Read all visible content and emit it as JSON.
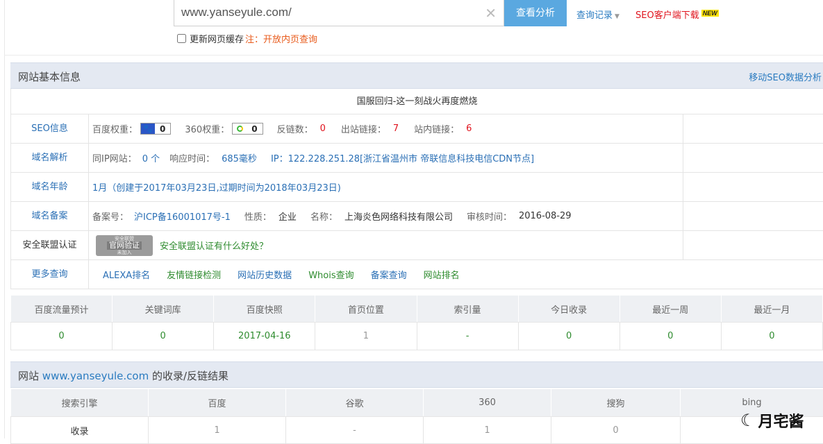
{
  "search": {
    "value": "www.yanseyule.com/",
    "submit_label": "查看分析",
    "history_label": "查询记录",
    "client_label": "SEO客户端下载",
    "new_badge": "NEW",
    "cache_label": "更新网页缓存",
    "cache_note": "注：开放内页查询"
  },
  "basic_info": {
    "title": "网站基本信息",
    "mobile_link": "移动SEO数据分析",
    "site_caption": "国服回归-这一刻战火再度燃烧",
    "seo": {
      "label": "SEO信息",
      "baidu_weight_label": "百度权重：",
      "baidu_weight": "0",
      "w360_label": "360权重：",
      "w360": "0",
      "backlinks_label": "反链数：",
      "backlinks": "0",
      "outlinks_label": "出站链接：",
      "outlinks": "7",
      "inlinks_label": "站内链接：",
      "inlinks": "6"
    },
    "dns": {
      "label": "域名解析",
      "same_ip_label": "同IP网站：",
      "same_ip": "0 个",
      "response_label": "响应时间：",
      "response": "685毫秒",
      "ip": "IP：122.228.251.28[浙江省温州市 帝联信息科技电信CDN节点]"
    },
    "age": {
      "label": "域名年龄",
      "value": "1月（创建于2017年03月23日,过期时间为2018年03月23日)"
    },
    "icp": {
      "label": "域名备案",
      "num_label": "备案号：",
      "num": "沪ICP备16001017号-1",
      "nature_label": "性质：",
      "nature": "企业",
      "name_label": "名称：",
      "name": "上海炎色网络科技有限公司",
      "audit_label": "审核时间：",
      "audit": "2016-08-29"
    },
    "alliance": {
      "label": "安全联盟认证",
      "seal_top": "安全联盟",
      "seal_mid": "官网验证",
      "seal_bottom": "未加入",
      "link": "安全联盟认证有什么好处？"
    },
    "more": {
      "label": "更多查询",
      "links": [
        "ALEXA排名",
        "友情链接检测",
        "网站历史数据",
        "Whois查询",
        "备案查询",
        "网站排名"
      ]
    }
  },
  "stats": {
    "headers": [
      "百度流量预计",
      "关键词库",
      "百度快照",
      "首页位置",
      "索引量",
      "今日收录",
      "最近一周",
      "最近一月"
    ],
    "values": [
      "0",
      "0",
      "2017-04-16",
      "1",
      "-",
      "0",
      "0",
      "0"
    ]
  },
  "results": {
    "title_prefix": "网站",
    "title_domain": "www.yanseyule.com",
    "title_suffix": "的收录/反链结果",
    "headers": [
      "搜索引擎",
      "百度",
      "谷歌",
      "360",
      "搜狗",
      "bing"
    ],
    "row": [
      "收录",
      "1",
      "-",
      "1",
      "0",
      ""
    ]
  },
  "watermark": {
    "text": "月宅酱"
  }
}
